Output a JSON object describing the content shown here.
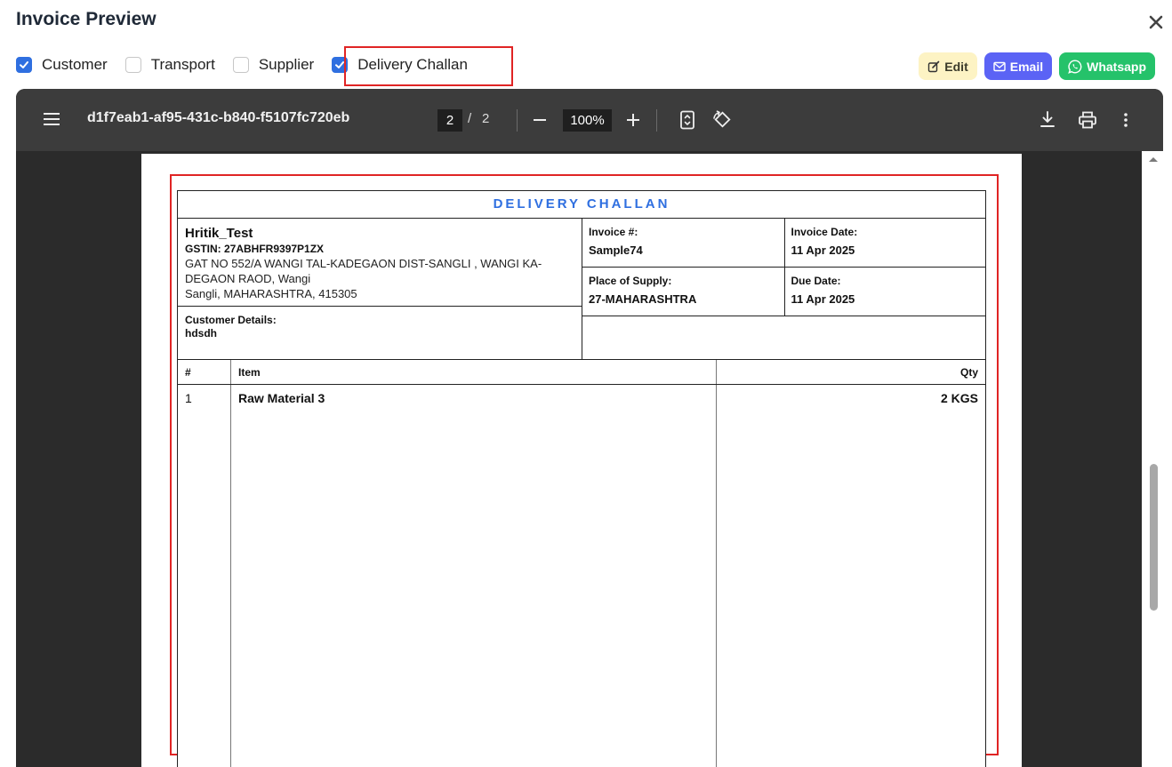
{
  "dialog": {
    "title": "Invoice Preview"
  },
  "options": [
    {
      "label": "Customer",
      "checked": true
    },
    {
      "label": "Transport",
      "checked": false
    },
    {
      "label": "Supplier",
      "checked": false
    },
    {
      "label": "Delivery Challan",
      "checked": true
    }
  ],
  "actions": {
    "edit": "Edit",
    "email": "Email",
    "whatsapp": "Whatsapp"
  },
  "viewer": {
    "filename": "d1f7eab1-af95-431c-b840-f5107fc720eb",
    "page": "2",
    "total_pages": "2",
    "zoom": "100%",
    "scroll_position": 0.72
  },
  "document": {
    "title": "DELIVERY CHALLAN",
    "supplier": {
      "name": "Hritik_Test",
      "gstin": "GSTIN: 27ABHFR9397P1ZX",
      "address_line1": "GAT NO 552/A WANGI TAL-KADEGAON DIST-SANGLI , WANGI KA-",
      "address_line2": "DEGAON RAOD, Wangi",
      "address_line3": "Sangli, MAHARASHTRA, 415305"
    },
    "customer": {
      "label": "Customer Details:",
      "value": "hdsdh"
    },
    "invoice_no_label": "Invoice #:",
    "invoice_no": "Sample74",
    "invoice_date_label": "Invoice Date:",
    "invoice_date": "11 Apr 2025",
    "supply_label": "Place of Supply:",
    "supply": "27-MAHARASHTRA",
    "due_label": "Due Date:",
    "due_date": "11 Apr 2025",
    "columns": {
      "no": "#",
      "item": "Item",
      "qty": "Qty"
    },
    "items": [
      {
        "no": "1",
        "item": "Raw Material 3",
        "qty": "2 KGS"
      }
    ]
  },
  "colors": {
    "accent": "#2f6fe0",
    "highlight": "#e02424",
    "email": "#5b63f5",
    "whatsapp": "#25c26a",
    "edit": "#fdf3c4"
  }
}
